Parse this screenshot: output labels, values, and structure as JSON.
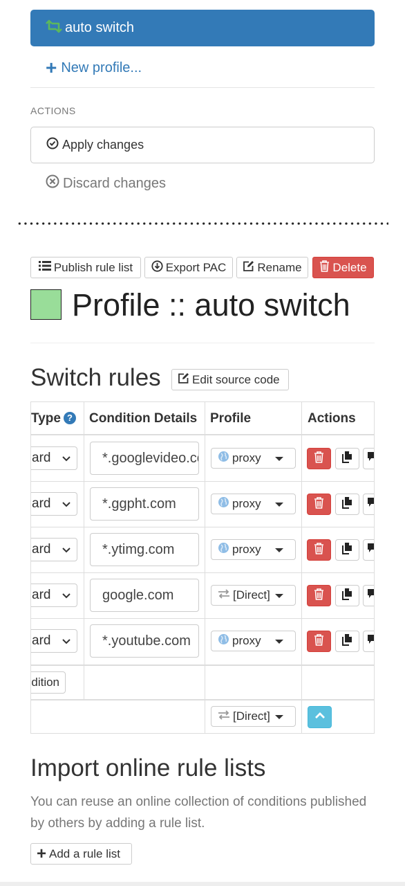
{
  "nav": {
    "active_profile": "auto switch",
    "new_profile": "New profile...",
    "actions_header": "ACTIONS",
    "apply_changes": "Apply changes",
    "discard_changes": "Discard changes"
  },
  "toolbar": {
    "publish": "Publish rule list",
    "export_pac": "Export PAC",
    "rename": "Rename",
    "delete": "Delete"
  },
  "profile": {
    "title": "Profile :: auto switch",
    "color": "#99dd99"
  },
  "switch_rules": {
    "heading": "Switch rules",
    "edit_source": "Edit source code",
    "columns": {
      "type": "Type",
      "condition": "Condition Details",
      "profile": "Profile",
      "actions": "Actions"
    },
    "rows": [
      {
        "type": "ard",
        "condition": "*.googlevideo.com",
        "profile": "proxy",
        "profile_icon": "globe-icon"
      },
      {
        "type": "ard",
        "condition": "*.ggpht.com",
        "profile": "proxy",
        "profile_icon": "globe-icon"
      },
      {
        "type": "ard",
        "condition": "*.ytimg.com",
        "profile": "proxy",
        "profile_icon": "globe-icon"
      },
      {
        "type": "ard",
        "condition": "google.com",
        "profile": "[Direct]",
        "profile_icon": "exchange-icon"
      },
      {
        "type": "ard",
        "condition": "*.youtube.com",
        "profile": "proxy",
        "profile_icon": "globe-icon"
      }
    ],
    "add_condition": "dition",
    "default_profile": "[Direct]"
  },
  "import": {
    "heading": "Import online rule lists",
    "help": "You can reuse an online collection of conditions published by others by adding a rule list.",
    "add_button": "Add a rule list"
  },
  "colors": {
    "primary": "#337ab7",
    "danger": "#d9534f",
    "info": "#5bc0de",
    "rule_green": "#5cb85c"
  }
}
